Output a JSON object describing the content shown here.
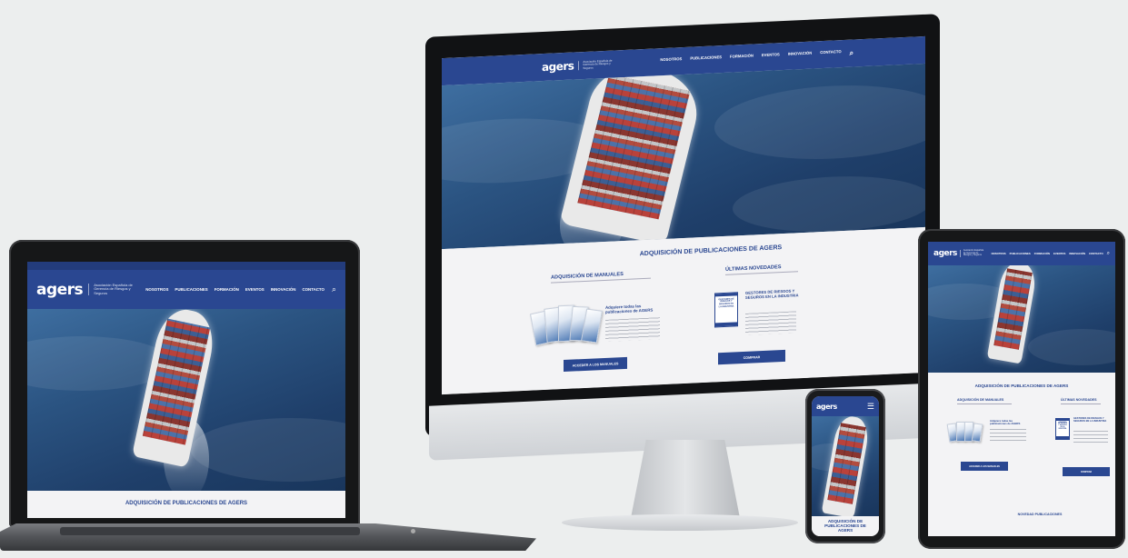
{
  "site": {
    "logo_text": "agers",
    "logo_tagline": "Asociación Española de Gerencia de Riesgos y Seguros",
    "nav": [
      "NOSOTROS",
      "PUBLICACIONES",
      "FORMACIÓN",
      "EVENTOS",
      "INNOVACIÓN",
      "CONTACTO"
    ],
    "section_title": "ADQUISICIÓN DE PUBLICACIONES DE AGERS",
    "col_manuales": "ADQUISICIÓN DE MANUALES",
    "col_novedades": "ÚLTIMAS NOVEDADES",
    "manuales_heading": "Adquiere todas las publicaciones de AGERS",
    "novedades_heading": "GESTORES DE RIESGOS Y SEGUROS EN LA INDUSTRIA",
    "btn_manuales": "ACCEDER A LOS MANUALES",
    "btn_novedades": "COMPRAR",
    "magazine_cover": "GESTORES DE RIESGOS Y SEGUROS EN LA INDUSTRIA",
    "footer_section": "NOVEDAD PUBLICACIONES"
  },
  "phone": {
    "hero_caption": "ADQUISICIÓN DE PUBLICACIONES DE AGERS"
  },
  "colors": {
    "brand_blue": "#2a4791",
    "logo_accent": "#e1322c"
  },
  "icons": [
    "search-icon",
    "menu-icon",
    "apple-logo"
  ]
}
